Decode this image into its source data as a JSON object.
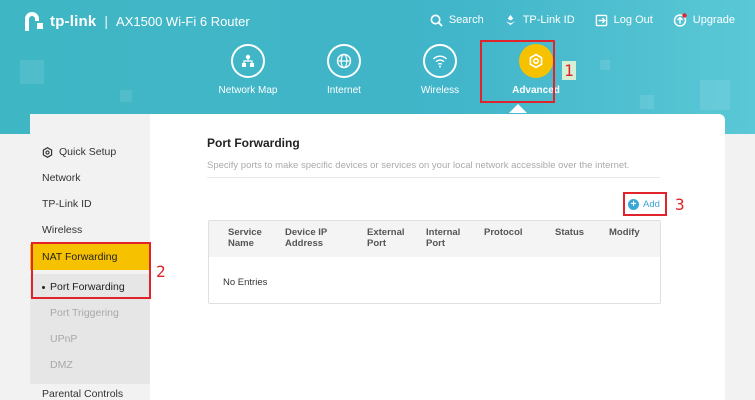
{
  "header": {
    "brand": "tp-link",
    "separator": "|",
    "model": "AX1500 Wi-Fi 6 Router",
    "links": [
      {
        "label": "Search",
        "icon": "search-icon"
      },
      {
        "label": "TP-Link ID",
        "icon": "tplink-id-icon"
      },
      {
        "label": "Log Out",
        "icon": "logout-icon"
      },
      {
        "label": "Upgrade",
        "icon": "upgrade-icon"
      }
    ],
    "nav": [
      {
        "label": "Network Map",
        "icon": "network-map-icon"
      },
      {
        "label": "Internet",
        "icon": "globe-icon"
      },
      {
        "label": "Wireless",
        "icon": "wifi-icon"
      },
      {
        "label": "Advanced",
        "icon": "gear-icon",
        "active": true
      }
    ]
  },
  "sidebar": {
    "items": [
      {
        "label": "Quick Setup",
        "icon": "quick-setup-icon"
      },
      {
        "label": "Network"
      },
      {
        "label": "TP-Link ID"
      },
      {
        "label": "Wireless"
      },
      {
        "label": "NAT Forwarding",
        "active": true
      },
      {
        "label": "Port Forwarding",
        "selected": true
      },
      {
        "label": "Port Triggering"
      },
      {
        "label": "UPnP"
      },
      {
        "label": "DMZ"
      },
      {
        "label": "Parental Controls"
      }
    ]
  },
  "main": {
    "title": "Port Forwarding",
    "description": "Specify ports to make specific devices or services on your local network accessible over the internet.",
    "add_label": "Add",
    "columns": [
      "Service Name",
      "Device IP Address",
      "External Port",
      "Internal Port",
      "Protocol",
      "Status",
      "Modify"
    ],
    "empty_text": "No Entries"
  },
  "annotations": [
    "1",
    "2",
    "3"
  ],
  "colors": {
    "accent": "#f6c200",
    "header": "#41b5c9",
    "link": "#3aa8d8",
    "annotation": "#e0242b"
  }
}
